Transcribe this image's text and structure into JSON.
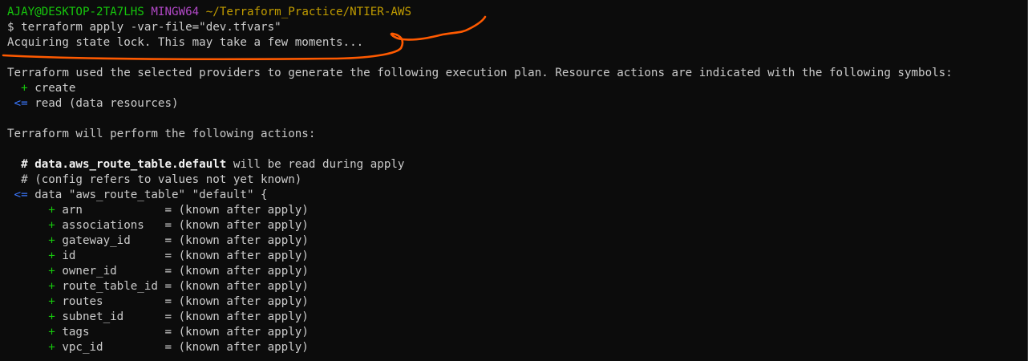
{
  "prompt": {
    "user_host": "AJAY@DESKTOP-2TA7LHS",
    "shell": "MINGW64",
    "cwd": "~/Terraform_Practice/NTIER-AWS"
  },
  "command": {
    "symbol": "$",
    "text": "terraform apply -var-file=\"dev.tfvars\""
  },
  "lock_message": "Acquiring state lock. This may take a few moments...",
  "plan_intro": "Terraform used the selected providers to generate the following execution plan. Resource actions are indicated with the following symbols:",
  "symbols": [
    {
      "sign": "+",
      "label": "create"
    },
    {
      "sign": "<=",
      "label": "read (data resources)"
    }
  ],
  "actions_header": "Terraform will perform the following actions:",
  "resource": {
    "comment_hash": "#",
    "address": "data.aws_route_table.default",
    "read_note": " will be read during apply",
    "config_note": "(config refers to values not yet known)",
    "read_sign": "<=",
    "declaration": "data \"aws_route_table\" \"default\" {",
    "attributes": [
      {
        "sign": "+",
        "name": "arn",
        "value": "= (known after apply)"
      },
      {
        "sign": "+",
        "name": "associations",
        "value": "= (known after apply)"
      },
      {
        "sign": "+",
        "name": "gateway_id",
        "value": "= (known after apply)"
      },
      {
        "sign": "+",
        "name": "id",
        "value": "= (known after apply)"
      },
      {
        "sign": "+",
        "name": "owner_id",
        "value": "= (known after apply)"
      },
      {
        "sign": "+",
        "name": "route_table_id",
        "value": "= (known after apply)"
      },
      {
        "sign": "+",
        "name": "routes",
        "value": "= (known after apply)"
      },
      {
        "sign": "+",
        "name": "subnet_id",
        "value": "= (known after apply)"
      },
      {
        "sign": "+",
        "name": "tags",
        "value": "= (known after apply)"
      },
      {
        "sign": "+",
        "name": "vpc_id",
        "value": "= (known after apply)"
      }
    ]
  },
  "colors": {
    "background": "#0c0c0c",
    "text": "#cccccc",
    "prompt_green": "#16c60c",
    "prompt_purple": "#b148c6",
    "prompt_yellow": "#c19c00",
    "read_blue": "#3b78ff",
    "annotation_orange": "#ff5a00"
  }
}
